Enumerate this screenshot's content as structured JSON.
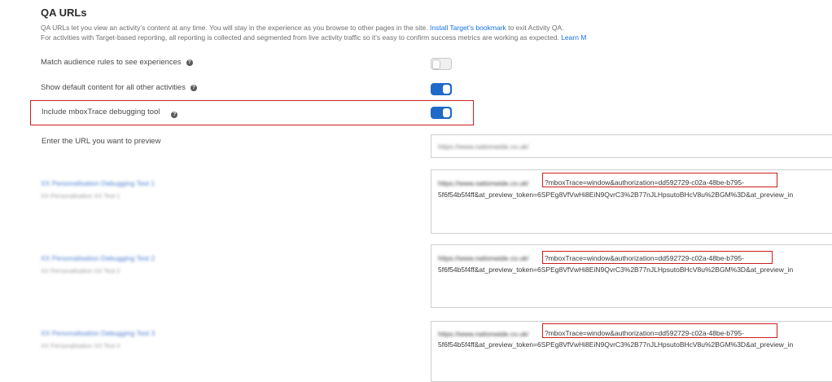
{
  "section": {
    "title": "QA URLs",
    "desc_line1_prefix": "QA URLs let you view an activity’s content at any time. You will stay in the experience as you browse to other pages in the site. ",
    "desc_line1_link": "Install Target’s bookmark",
    "desc_line1_suffix": " to exit Activity QA.",
    "desc_line2_prefix": "For activities with Target-based reporting, all reporting is collected and segmented from live activity traffic so it’s easy to confirm success metrics are working as expected. ",
    "desc_line2_link": "Learn M"
  },
  "settings": [
    {
      "label": "Match audience rules to see experiences",
      "help": "?",
      "toggle": "off"
    },
    {
      "label": "Show default content for all other activities",
      "help": "?",
      "toggle": "on"
    },
    {
      "label": "Include mboxTrace debugging tool",
      "help": "?",
      "toggle": "on"
    }
  ],
  "preview": {
    "label": "Enter the URL you want to preview",
    "value": "https://www.nationwide.co.uk/"
  },
  "experiences": [
    {
      "name": "XX Personalisation Debugging Test 1",
      "subtitle": "XX Personalisation XX Test 1",
      "url_prefix": "https://www.nationwide.co.uk/",
      "url_highlight": "?mboxTrace=window&authorization=dd592729-c02a-48be-b795-",
      "url_line2": "5f6f54b5f4ff&at_preview_token=6SPEg8VfVwHi8EiN9QvrC3%2B77nJLHpsutoBHcV8u%2BGM%3D&at_preview_in"
    },
    {
      "name": "XX Personalisation Debugging Test 2",
      "subtitle": "XX Personalisation XX Test 2",
      "url_prefix": "https://www.nationwide.co.uk/",
      "url_highlight": "?mboxTrace=window&authorization=dd592729-c02a-48be-b795-",
      "url_line2": "5f6f54b5f4ff&at_preview_token=6SPEg8VfVwHi8EiN9QvrC3%2B77nJLHpsutoBHcV8u%2BGM%3D&at_preview_in"
    },
    {
      "name": "XX Personalisation Debugging Test 3",
      "subtitle": "XX Personalisation XX Test 3",
      "url_prefix": "https://www.nationwide.co.uk/",
      "url_highlight": "?mboxTrace=window&authorization=dd592729-c02a-48be-b795-",
      "url_line2": "5f6f54b5f4ff&at_preview_token=6SPEg8VfVwHi8EiN9QvrC3%2B77nJLHpsutoBHcV8u%2BGM%3D&at_preview_in"
    }
  ],
  "colors": {
    "accent": "#1f69c8",
    "link": "#1473e6",
    "highlight": "#cc1f1f"
  }
}
